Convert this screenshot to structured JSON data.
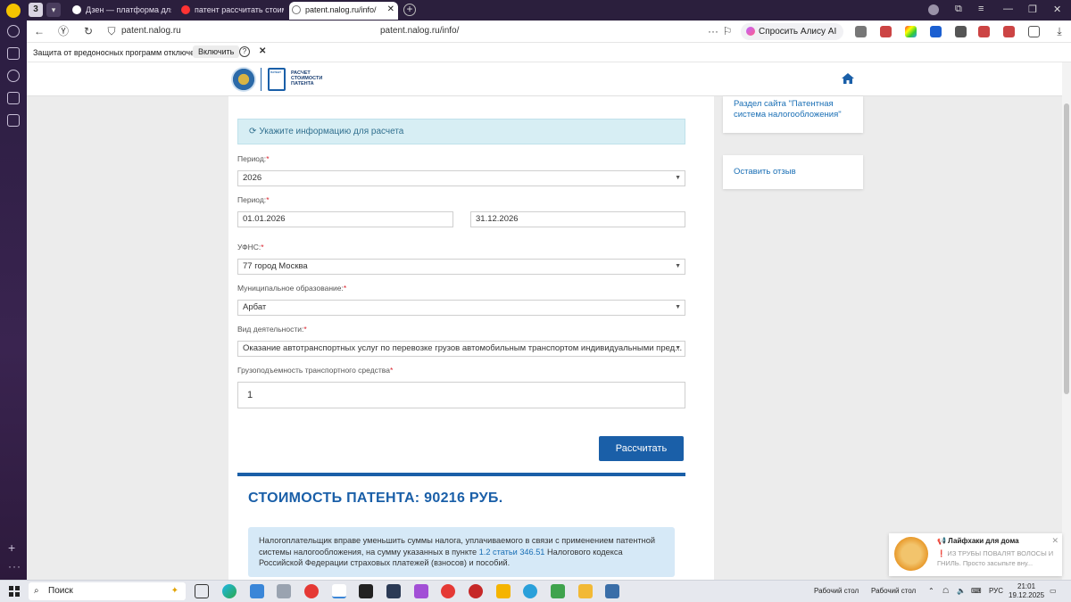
{
  "browser": {
    "tab_count": "3",
    "tabs": [
      {
        "title": "Дзен — платформа для п"
      },
      {
        "title": "патент рассчитать стоим"
      },
      {
        "title": "patent.nalog.ru/info/",
        "active": true
      }
    ],
    "address_domain": "patent.nalog.ru",
    "address_url": "patent.nalog.ru/info/",
    "alisa_button": "Спросить Алису AI",
    "protection_text": "Защита от вредоносных программ отключена",
    "protection_enable": "Включить"
  },
  "form": {
    "info_banner": "Укажите информацию для расчета",
    "period_label": "Период:",
    "period_year": "2026",
    "period_dates_label": "Период:",
    "date_from": "01.01.2026",
    "date_to": "31.12.2026",
    "ufns_label": "УФНС:",
    "ufns_value": "77 город Москва",
    "municipal_label": "Муниципальное образование:",
    "municipal_value": "Арбат",
    "activity_label": "Вид деятельности:",
    "activity_value": "Оказание автотранспортных услуг по перевозке грузов автомобильным транспортом индивидуальными пред...",
    "capacity_label": "Грузоподъемность транспортного средства",
    "capacity_value": "1",
    "required_mark": "*",
    "calculate_button": "Рассчитать"
  },
  "result": {
    "title": "СТОИМОСТЬ ПАТЕНТА: 90216 РУБ.",
    "note_part1": "Налогоплательщик вправе уменьшить суммы налога, уплачиваемого в связи с применением патентной системы налогообложения, на сумму указанных в пункте ",
    "note_link": "1.2 статьи 346.51",
    "note_part2": " Налогового кодекса Российской Федерации страховых платежей (взносов) и пособий."
  },
  "sidebar": {
    "section_link": "Раздел сайта \"Патентная система налогообложения\"",
    "feedback_link": "Оставить отзыв"
  },
  "logo": {
    "line1": "РАСЧЕТ",
    "line2": "СТОИМОСТИ",
    "line3": "ПАТЕНТА",
    "badge": "ПАТЕНТ"
  },
  "notification": {
    "title": "📢 Лайфхаки для дома",
    "body": "❗ ИЗ ТРУБЫ ПОВАЛЯТ ВОЛОСЫ И ГНИЛЬ. Просто засыпьте вну..."
  },
  "taskbar": {
    "search_label": "Поиск",
    "desktop1": "Рабочий стол",
    "desktop2": "Рабочий стол",
    "lang": "РУС",
    "time": "21:01",
    "date": "19.12.2025"
  },
  "colors": {
    "primary": "#1a5fa8",
    "info_bg": "#d7eef4",
    "note_bg": "#d6e9f7",
    "required": "#d9232d"
  }
}
